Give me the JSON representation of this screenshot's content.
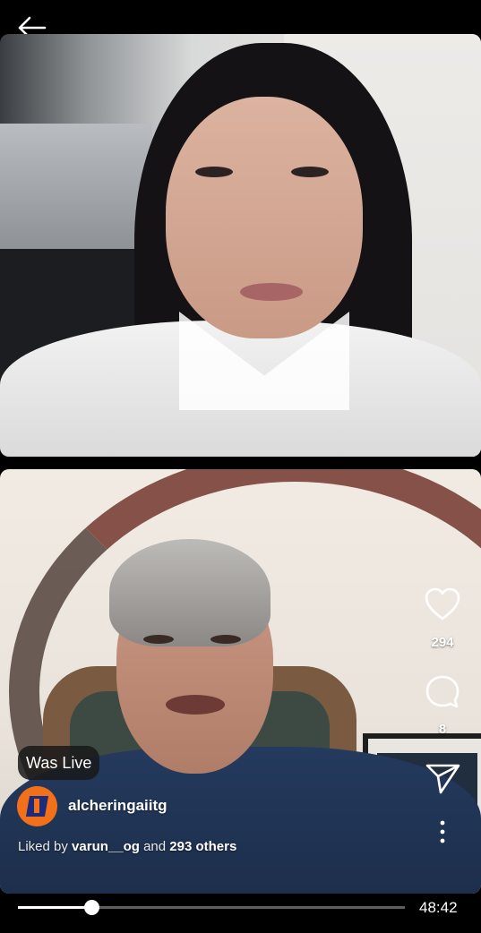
{
  "status": {
    "was_live": "Was Live"
  },
  "actions": {
    "likes_count": "294",
    "comments_count": "8"
  },
  "post": {
    "username": "alcheringaiitg",
    "liked_by_prefix": "Liked by",
    "liked_by_user": "varun__og",
    "liked_by_and": "and",
    "liked_by_others": "293 others"
  },
  "player": {
    "duration": "48:42",
    "progress": 0.19
  },
  "icons": {
    "back": "arrow-left-icon",
    "like": "heart-icon",
    "comment": "comment-bubble-icon",
    "share": "send-icon",
    "more": "more-vertical-icon"
  },
  "colors": {
    "background": "#000000",
    "avatar_brand": "#f2701a",
    "text": "#ffffff",
    "progress_track": "#5e5e5e"
  }
}
